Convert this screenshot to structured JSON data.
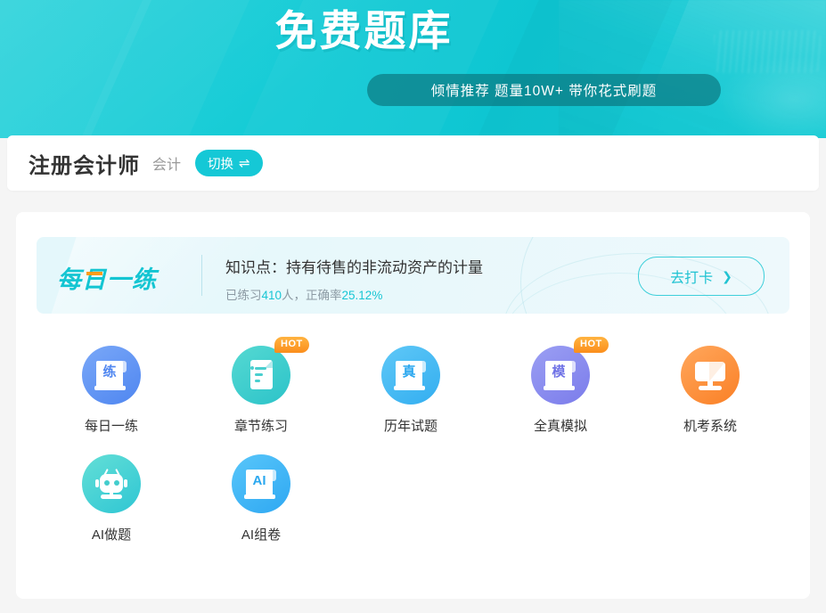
{
  "banner": {
    "title": "免费题库",
    "subtitle": "倾情推荐 题量10W+ 带你花式刷题"
  },
  "title_bar": {
    "exam_name": "注册会计师",
    "subject_name": "会计",
    "switch_label": "切换",
    "switch_icon": "swap-arrows-icon"
  },
  "daily_practice": {
    "logo_part1": "每",
    "logo_part2": "日",
    "logo_part3": "一练",
    "knowledge_point": "知识点：持有待售的非流动资产的计量",
    "stats_prefix": "已练习",
    "stats_count": "410",
    "stats_middle": "人，正确率",
    "stats_accuracy": "25.12%",
    "button_label": "去打卡",
    "button_icon": "chevron-right-icon"
  },
  "entries": [
    {
      "label": "每日一练",
      "icon": "scroll-practice-icon",
      "char": "练",
      "badge": ""
    },
    {
      "label": "章节练习",
      "icon": "document-chapter-icon",
      "char": "",
      "badge": "HOT"
    },
    {
      "label": "历年试题",
      "icon": "scroll-exam-icon",
      "char": "真",
      "badge": ""
    },
    {
      "label": "全真模拟",
      "icon": "scroll-mock-icon",
      "char": "模",
      "badge": "HOT"
    },
    {
      "label": "机考系统",
      "icon": "monitor-icon",
      "char": "",
      "badge": ""
    },
    {
      "label": "AI做题",
      "icon": "robot-icon",
      "char": "",
      "badge": ""
    },
    {
      "label": "AI组卷",
      "icon": "scroll-ai-icon",
      "char": "AI",
      "badge": ""
    }
  ],
  "colors": {
    "brand_teal": "#15c8d6",
    "accent_orange": "#fa8026",
    "page_bg": "#f5f5f5",
    "card_bg": "#ffffff"
  }
}
